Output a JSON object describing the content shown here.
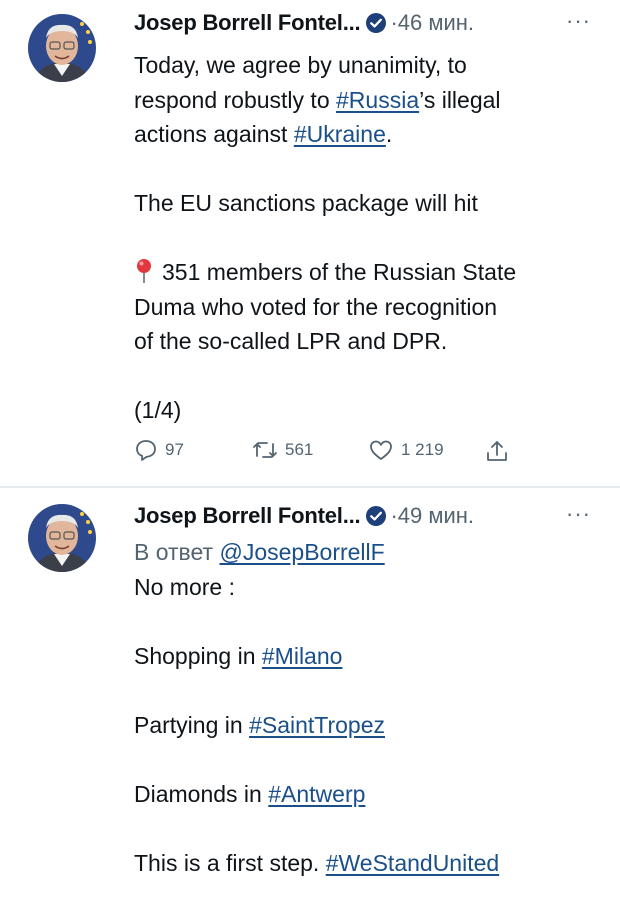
{
  "tweets": [
    {
      "author": "Josep Borrell Fontel...",
      "time": "·46 мин.",
      "more": "···",
      "text": {
        "p1_a": "Today, we agree by unanimity, to",
        "p1_b_pre": "respond robustly to ",
        "p1_b_link": "#Russia",
        "p1_b_post": "’s illegal",
        "p1_c_pre": "actions against ",
        "p1_c_link": "#Ukraine",
        "p1_c_post": ".",
        "p2": "The EU sanctions package will hit",
        "p3_emoji": "pushpin-icon",
        "p3_a": "351 members of the Russian State",
        "p3_b": "Duma who voted for the recognition",
        "p3_c": "of the so-called LPR and DPR.",
        "p4": "(1/4)"
      },
      "actions": {
        "replies": "97",
        "retweets": "561",
        "likes": "1 219"
      }
    },
    {
      "author": "Josep Borrell Fontel...",
      "time": "·49 мин.",
      "more": "···",
      "reply_prefix": "В ответ ",
      "reply_handle": "@JosepBorrellF",
      "text": {
        "l1": "No more :",
        "l2_pre": "Shopping in ",
        "l2_link": "#Milano",
        "l3_pre": "Partying in ",
        "l3_link": "#SaintTropez",
        "l4_pre": "Diamonds in ",
        "l4_link": "#Antwerp",
        "l5_pre": "This is a first step. ",
        "l5_link": "#WeStandUnited"
      }
    }
  ],
  "colors": {
    "link": "#1a4f8a",
    "verified": "#1d9bf0",
    "muted": "#536471"
  }
}
